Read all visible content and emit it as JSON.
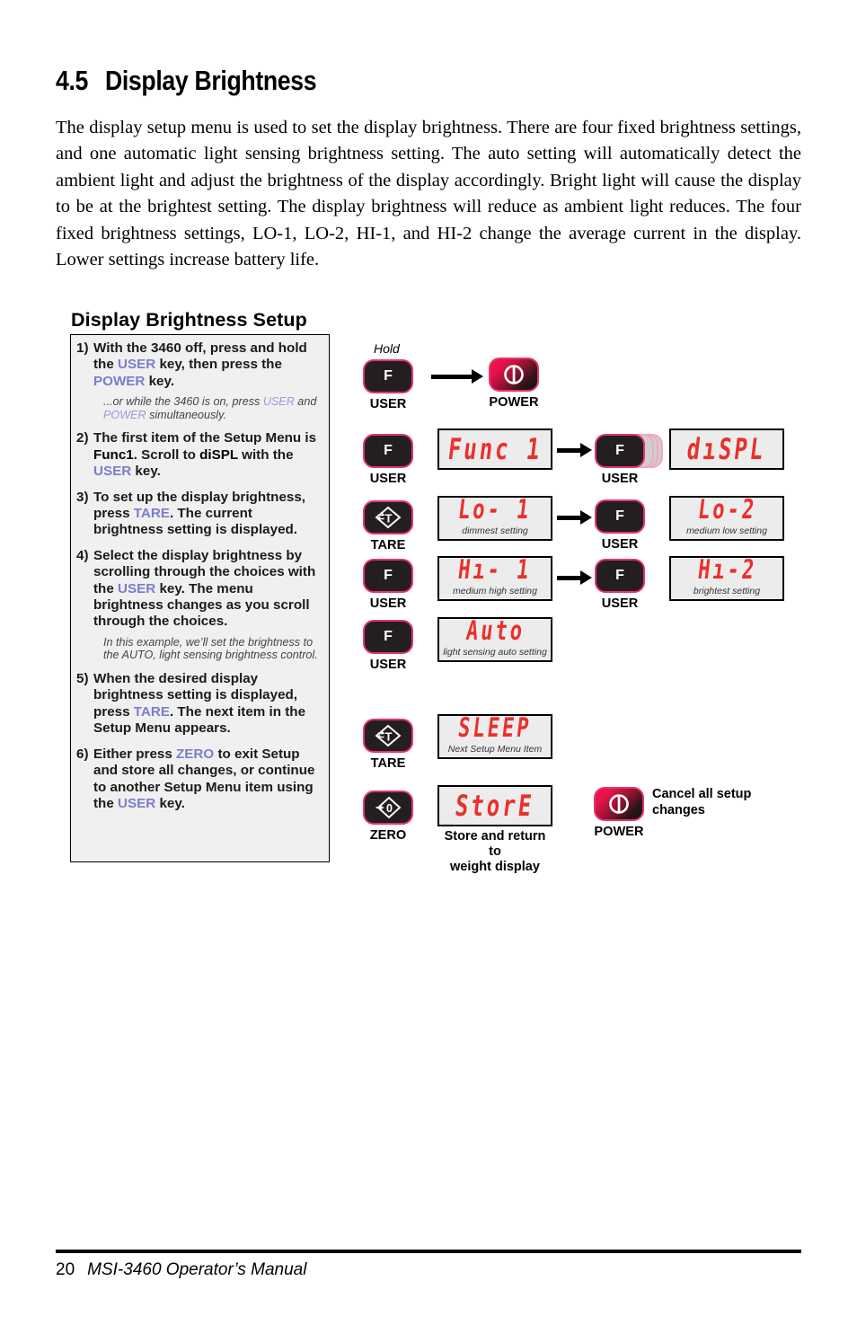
{
  "section": {
    "number": "4.5",
    "title": "Display Brightness",
    "paragraph": "The display setup menu is used to set the display brightness. There are four fixed brightness settings, and one automatic light sensing brightness setting. The auto setting will automatically detect the ambient light and adjust the brightness of the display accordingly. Bright light will cause the display to be at the brightest setting. The display brightness will reduce as ambient light reduces. The four fixed brightness settings, LO-1, LO-2, HI-1, and HI-2 change the average current in the display. Lower settings increase battery life."
  },
  "setup": {
    "heading": "Display Brightness Setup",
    "steps": [
      {
        "num": "1)",
        "parts": [
          {
            "t": "With the 3460 off, press and hold the ",
            "s": "n"
          },
          {
            "t": "USER",
            "s": "kw"
          },
          {
            "t": " key, then press the ",
            "s": "n"
          },
          {
            "t": "POWER",
            "s": "kw"
          },
          {
            "t": " key.",
            "s": "n"
          }
        ],
        "note": [
          {
            "t": "...or while the 3460 is on, press ",
            "s": "n"
          },
          {
            "t": "USER",
            "s": "kw"
          },
          {
            "t": " and ",
            "s": "n"
          },
          {
            "t": "POWER",
            "s": "kw"
          },
          {
            "t": " simultaneously.",
            "s": "n"
          }
        ]
      },
      {
        "num": "2)",
        "parts": [
          {
            "t": "The first item of the Setup Menu is ",
            "s": "n"
          },
          {
            "t": "Func1",
            "s": "b"
          },
          {
            "t": ". Scroll to ",
            "s": "n"
          },
          {
            "t": "diSPL",
            "s": "b"
          },
          {
            "t": " with the ",
            "s": "n"
          },
          {
            "t": "USER",
            "s": "kw"
          },
          {
            "t": " key.",
            "s": "n"
          }
        ],
        "note": null
      },
      {
        "num": "3)",
        "parts": [
          {
            "t": "To set up the display brightness, press ",
            "s": "n"
          },
          {
            "t": "TARE",
            "s": "kw"
          },
          {
            "t": ". The current brightness setting is displayed.",
            "s": "n"
          }
        ],
        "note": null
      },
      {
        "num": "4)",
        "parts": [
          {
            "t": "Select the display brightness by scrolling through the choices with the ",
            "s": "n"
          },
          {
            "t": "USER",
            "s": "kw"
          },
          {
            "t": " key. The menu brightness changes as you scroll through the choices.",
            "s": "n"
          }
        ],
        "note": [
          {
            "t": "In this example, we’ll set the brightness to the AUTO, light sensing brightness control.",
            "s": "n"
          }
        ]
      },
      {
        "num": "5)",
        "parts": [
          {
            "t": "When the desired display brightness setting is displayed, press ",
            "s": "n"
          },
          {
            "t": "TARE",
            "s": "kw"
          },
          {
            "t": ". The next item in the Setup Menu appears.",
            "s": "n"
          }
        ],
        "note": null
      },
      {
        "num": "6)",
        "parts": [
          {
            "t": "Either press ",
            "s": "n"
          },
          {
            "t": "ZERO",
            "s": "kw"
          },
          {
            "t": " to exit Setup and store all changes, or continue to another Setup Menu item using the ",
            "s": "n"
          },
          {
            "t": "USER",
            "s": "kw"
          },
          {
            "t": " key.",
            "s": "n"
          }
        ],
        "note": null
      }
    ]
  },
  "diagram": {
    "hold_label": "Hold",
    "keys": {
      "user": "USER",
      "power": "POWER",
      "tare": "TARE",
      "zero": "ZERO",
      "user_face": "F"
    },
    "displays": {
      "func1": {
        "text": "Func 1",
        "caption": ""
      },
      "dispL": {
        "text": "dıSPL",
        "caption": ""
      },
      "lo1": {
        "text": "Lo- 1",
        "caption": "dimmest setting"
      },
      "lo2": {
        "text": "Lo-2",
        "caption": "medium low setting"
      },
      "hi1": {
        "text": "Hı- 1",
        "caption": "medium high setting"
      },
      "hi2": {
        "text": "Hı-2",
        "caption": "brightest setting"
      },
      "auto": {
        "text": "Auto",
        "caption": "light sensing auto setting"
      },
      "sleep": {
        "text": "SLEEP",
        "caption": "Next Setup Menu Item"
      },
      "store": {
        "text": "StorE",
        "caption": ""
      }
    },
    "captions": {
      "store_note": "Store and return to\nweight display",
      "power_note": "Cancel all setup\nchanges"
    }
  },
  "footer": {
    "page": "20",
    "manual": "MSI-3460 Operator’s Manual"
  },
  "colors": {
    "keyword": "#7c7ccd",
    "lcd_red": "#ec2f2a",
    "key_edge": "#e8336b",
    "key_body": "#231f20"
  }
}
